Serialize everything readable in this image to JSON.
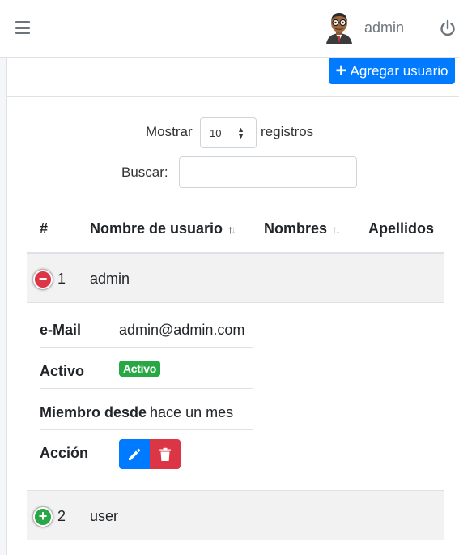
{
  "header": {
    "user_name": "admin",
    "icons": {
      "menu": "hamburger-icon",
      "logout": "power-icon"
    }
  },
  "toolbar": {
    "add_user_label": "Agregar usuario"
  },
  "table_controls": {
    "show_label": "Mostrar",
    "page_length": "10",
    "records_label": "registros",
    "search_label": "Buscar:",
    "search_value": ""
  },
  "table": {
    "columns": [
      "#",
      "Nombre de usuario",
      "Nombres",
      "Apellidos"
    ],
    "rows": [
      {
        "number": "1",
        "username": "admin",
        "expanded": true,
        "details": {
          "email_label": "e-Mail",
          "email": "admin@admin.com",
          "active_label": "Activo",
          "active_badge": "Activo",
          "member_label": "Miembro desde",
          "member_since": "hace un mes",
          "action_label": "Acción"
        }
      },
      {
        "number": "2",
        "username": "user",
        "expanded": false
      }
    ]
  },
  "colors": {
    "primary": "#007bff",
    "danger": "#dc3545",
    "success": "#28a745",
    "muted": "#6c757d"
  }
}
